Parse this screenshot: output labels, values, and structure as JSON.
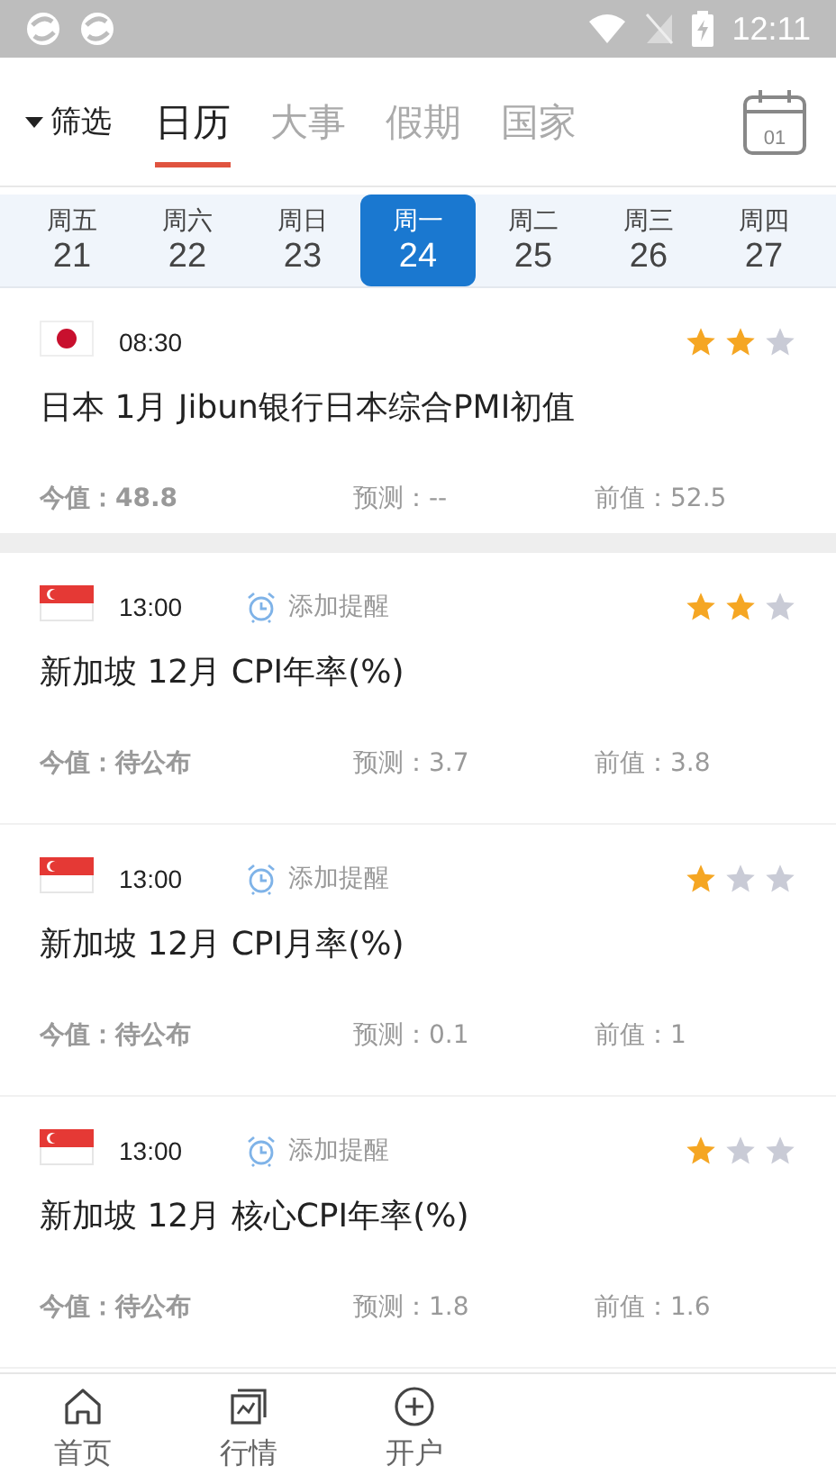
{
  "status_bar": {
    "time": "12:11"
  },
  "header": {
    "filter": "筛选",
    "tabs": [
      {
        "label": "日历",
        "selected": true
      },
      {
        "label": "大事",
        "selected": false
      },
      {
        "label": "假期",
        "selected": false
      },
      {
        "label": "国家",
        "selected": false
      }
    ],
    "calendar_button": "01"
  },
  "date_strip": [
    {
      "weekday": "周五",
      "day": "21",
      "selected": false
    },
    {
      "weekday": "周六",
      "day": "22",
      "selected": false
    },
    {
      "weekday": "周日",
      "day": "23",
      "selected": false
    },
    {
      "weekday": "周一",
      "day": "24",
      "selected": true
    },
    {
      "weekday": "周二",
      "day": "25",
      "selected": false
    },
    {
      "weekday": "周三",
      "day": "26",
      "selected": false
    },
    {
      "weekday": "周四",
      "day": "27",
      "selected": false
    }
  ],
  "events": [
    {
      "kind": "japan",
      "time": "08:30",
      "title": "日本 1月 Jibun银行日本综合PMI初值",
      "stars": 2,
      "actual": "今值：48.8",
      "forecast": "预测：--",
      "previous": "前值：52.5"
    },
    {
      "kind": "singapore",
      "time": "13:00",
      "reminder": "添加提醒",
      "title": "新加坡 12月 CPI年率(%)",
      "stars": 2,
      "actual": "今值：待公布",
      "forecast": "预测：3.7",
      "previous": "前值：3.8"
    },
    {
      "kind": "singapore",
      "time": "13:00",
      "reminder": "添加提醒",
      "title": "新加坡 12月 CPI月率(%)",
      "stars": 1,
      "actual": "今值：待公布",
      "forecast": "预测：0.1",
      "previous": "前值：1"
    },
    {
      "kind": "singapore",
      "time": "13:00",
      "reminder": "添加提醒",
      "title": "新加坡 12月 核心CPI年率(%)",
      "stars": 1,
      "actual": "今值：待公布",
      "forecast": "预测：1.8",
      "previous": "前值：1.6"
    }
  ],
  "bottom_nav": [
    {
      "kind": "home",
      "label": "首页"
    },
    {
      "kind": "chart",
      "label": "行情"
    },
    {
      "kind": "plus",
      "label": "开户"
    }
  ]
}
